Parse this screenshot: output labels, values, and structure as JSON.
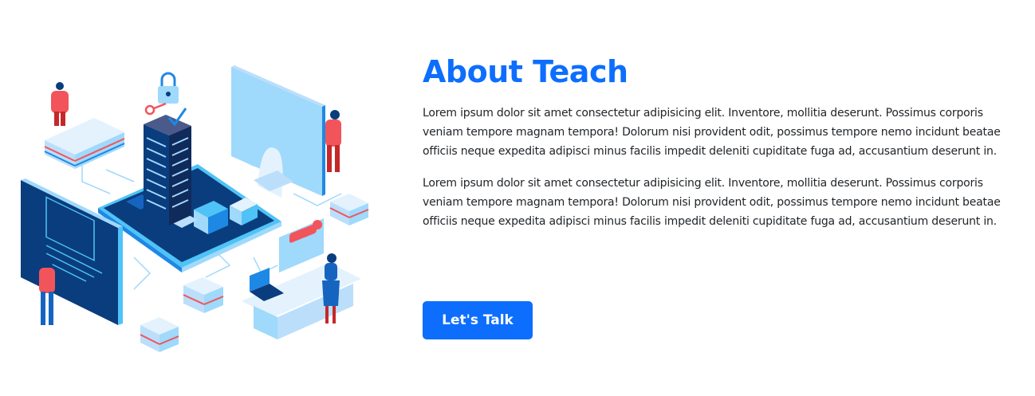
{
  "about": {
    "title": "About Teach",
    "paragraphs": [
      "Lorem ipsum dolor sit amet consectetur adipisicing elit. Inventore, mollitia deserunt. Possimus corporis veniam tempore magnam tempora! Dolorum nisi provident odit, possimus tempore nemo incidunt beatae officiis neque expedita adipisci minus facilis impedit deleniti cupiditate fuga ad, accusantium deserunt in.",
      "Lorem ipsum dolor sit amet consectetur adipisicing elit. Inventore, mollitia deserunt. Possimus corporis veniam tempore magnam tempora! Dolorum nisi provident odit, possimus tempore nemo incidunt beatae officiis neque expedita adipisci minus facilis impedit deleniti cupiditate fuga ad, accusantium deserunt in."
    ],
    "cta_label": "Let's Talk"
  },
  "colors": {
    "accent": "#0d6efd",
    "text": "#212529",
    "illustration_dark": "#0a3d7d",
    "illustration_light": "#9fd9fb",
    "illustration_red": "#f2545b"
  },
  "illustration": {
    "icons": [
      "isometric-city-building",
      "monitor",
      "padlock",
      "key",
      "blueprint-board",
      "laptop",
      "rating-card",
      "server-stack",
      "person-figure"
    ]
  }
}
